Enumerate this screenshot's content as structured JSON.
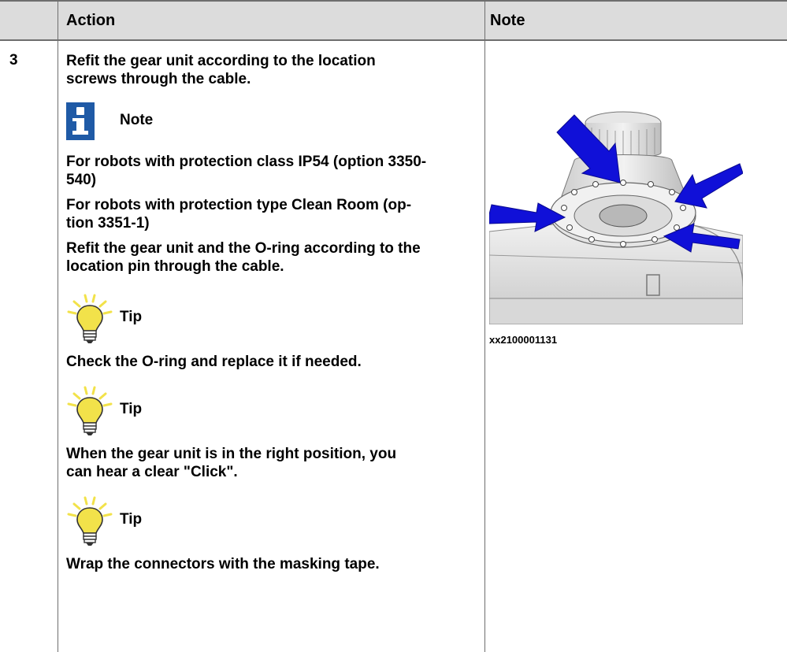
{
  "header": {
    "col_action": "Action",
    "col_note": "Note"
  },
  "step": {
    "number": "3",
    "intro_line1": "Refit the gear unit according to the location",
    "intro_line2": "screws through the cable.",
    "note_label": "Note",
    "note_line1": "For robots with protection class IP54 (option 3350-",
    "note_line2": "540)",
    "note_line3": "For robots with protection type Clean Room (op-",
    "note_line4": "tion 3351-1)",
    "note_line5": "Refit the gear unit and the O-ring according to the",
    "note_line6": "location pin through the cable.",
    "tip1_label": "Tip",
    "tip1_text": "Check the O-ring and replace it if needed.",
    "tip2_label": "Tip",
    "tip2_line1": "When the gear unit is in the right position, you",
    "tip2_line2": "can hear a clear \"Click\".",
    "tip3_label": "Tip",
    "tip3_text": "Wrap the connectors with the masking tape."
  },
  "note_cell": {
    "image_caption": "xx2100001131",
    "image_icon": "gear-unit-illustration"
  },
  "colors": {
    "header_bg": "#dcdcdc",
    "rule": "#6e6e6e",
    "note_icon": "#1f5aa6",
    "tip_bulb": "#f2e24a",
    "arrow": "#1010d8"
  }
}
